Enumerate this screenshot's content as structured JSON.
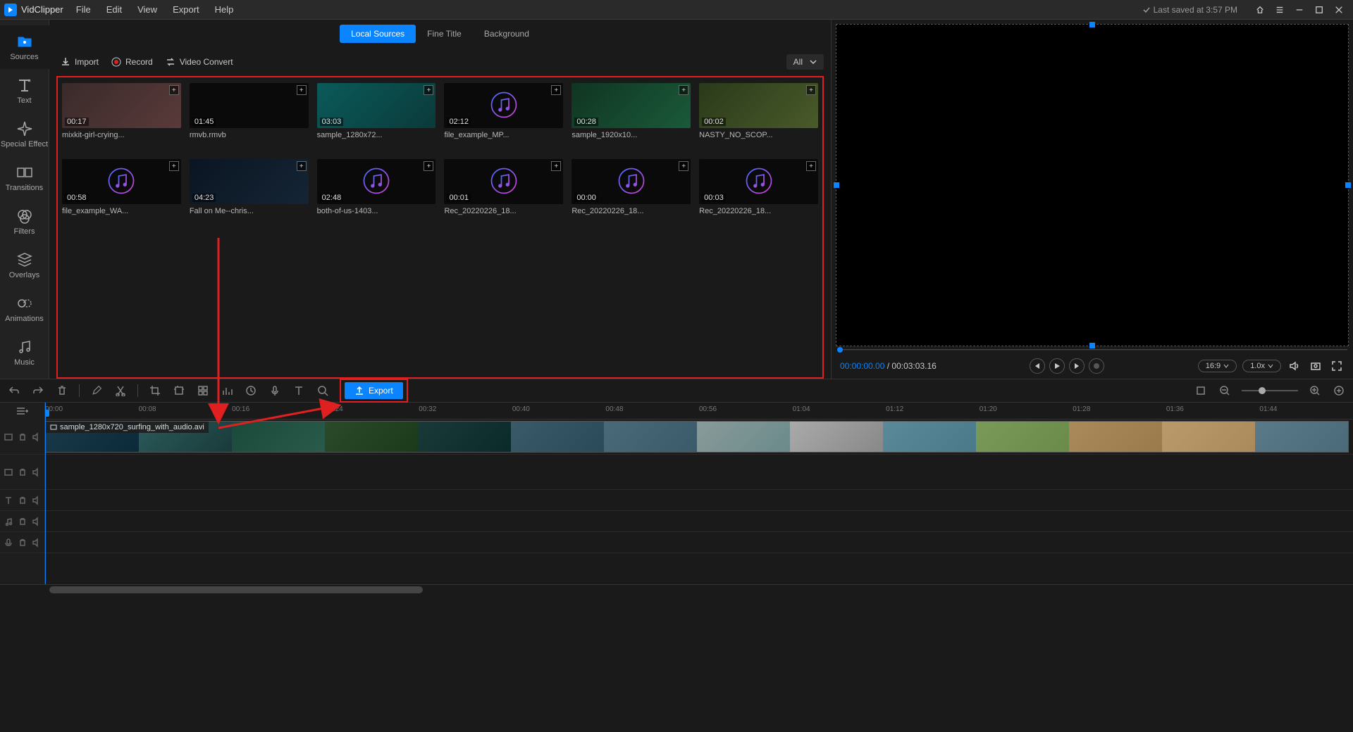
{
  "app": {
    "name": "VidClipper"
  },
  "menu": [
    "File",
    "Edit",
    "View",
    "Export",
    "Help"
  ],
  "saved_text": "Last saved at 3:57 PM",
  "sidebar": {
    "items": [
      {
        "label": "Sources"
      },
      {
        "label": "Text"
      },
      {
        "label": "Special Effect"
      },
      {
        "label": "Transitions"
      },
      {
        "label": "Filters"
      },
      {
        "label": "Overlays"
      },
      {
        "label": "Animations"
      },
      {
        "label": "Music"
      }
    ]
  },
  "media_tabs": [
    "Local Sources",
    "Fine Title",
    "Background"
  ],
  "tools": {
    "import": "Import",
    "record": "Record",
    "convert": "Video Convert"
  },
  "filter_label": "All",
  "media": [
    {
      "dur": "00:17",
      "name": "mixkit-girl-crying...",
      "kind": "vid",
      "cls": "th-img1"
    },
    {
      "dur": "01:45",
      "name": "rmvb.rmvb",
      "kind": "vid",
      "cls": ""
    },
    {
      "dur": "03:03",
      "name": "sample_1280x72...",
      "kind": "vid",
      "cls": "th-img3"
    },
    {
      "dur": "02:12",
      "name": "file_example_MP...",
      "kind": "aud",
      "cls": ""
    },
    {
      "dur": "00:28",
      "name": "sample_1920x10...",
      "kind": "vid",
      "cls": "th-img5"
    },
    {
      "dur": "00:02",
      "name": "NASTY_NO_SCOP...",
      "kind": "vid",
      "cls": "th-img6"
    },
    {
      "dur": "00:58",
      "name": "file_example_WA...",
      "kind": "aud",
      "cls": ""
    },
    {
      "dur": "04:23",
      "name": "Fall on Me--chris...",
      "kind": "vid",
      "cls": "th-img8"
    },
    {
      "dur": "02:48",
      "name": "both-of-us-1403...",
      "kind": "aud",
      "cls": ""
    },
    {
      "dur": "00:01",
      "name": "Rec_20220226_18...",
      "kind": "aud",
      "cls": ""
    },
    {
      "dur": "00:00",
      "name": "Rec_20220226_18...",
      "kind": "aud",
      "cls": ""
    },
    {
      "dur": "00:03",
      "name": "Rec_20220226_18...",
      "kind": "aud",
      "cls": ""
    }
  ],
  "preview": {
    "cur": "00:00:00.00",
    "sep": " / ",
    "total": "00:03:03.16",
    "ratio": "16:9",
    "speed": "1.0x"
  },
  "export_label": "Export",
  "ruler": [
    "00:00",
    "00:08",
    "00:16",
    "00:24",
    "00:32",
    "00:40",
    "00:48",
    "00:56",
    "01:04",
    "01:12",
    "01:20",
    "01:28",
    "01:36",
    "01:44"
  ],
  "clip_name": "sample_1280x720_surfing_with_audio.avi"
}
